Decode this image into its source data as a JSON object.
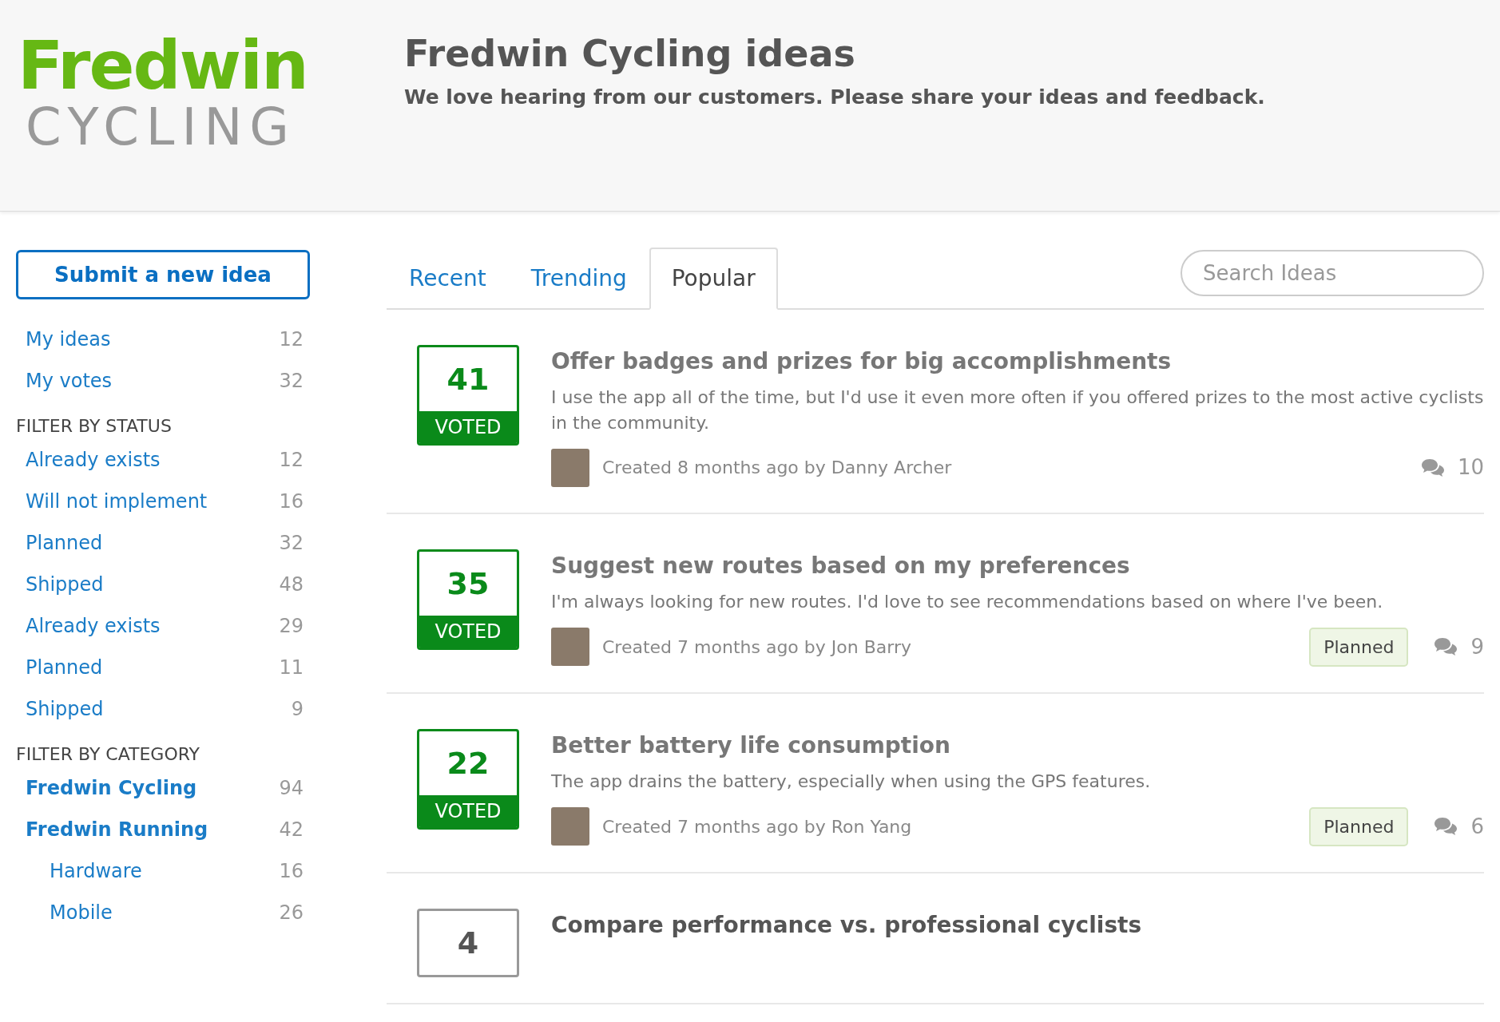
{
  "header": {
    "logo": {
      "brand": "Fredwin",
      "subtitle": "CYCLING"
    },
    "title": "Fredwin Cycling ideas",
    "tagline": "We love hearing from our customers. Please share your ideas and feedback."
  },
  "sidebar": {
    "submit_button": "Submit a new idea",
    "my_items": [
      {
        "label": "My ideas",
        "count": "12"
      },
      {
        "label": "My votes",
        "count": "32"
      }
    ],
    "status_heading": "FILTER BY STATUS",
    "statuses": [
      {
        "label": "Already exists",
        "count": "12"
      },
      {
        "label": "Will not implement",
        "count": "16"
      },
      {
        "label": "Planned",
        "count": "32"
      },
      {
        "label": "Shipped",
        "count": "48"
      },
      {
        "label": "Already exists",
        "count": "29"
      },
      {
        "label": "Planned",
        "count": "11"
      },
      {
        "label": "Shipped",
        "count": "9"
      }
    ],
    "category_heading": "FILTER BY CATEGORY",
    "categories": [
      {
        "label": "Fredwin Cycling",
        "count": "94"
      },
      {
        "label": "Fredwin Running",
        "count": "42",
        "children": [
          {
            "label": "Hardware",
            "count": "16"
          },
          {
            "label": "Mobile",
            "count": "26"
          }
        ]
      }
    ]
  },
  "tabs": [
    {
      "label": "Recent",
      "selected": false
    },
    {
      "label": "Trending",
      "selected": false
    },
    {
      "label": "Popular",
      "selected": true
    }
  ],
  "search": {
    "placeholder": "Search Ideas"
  },
  "ideas": [
    {
      "votes": "41",
      "voted": true,
      "vote_label": "VOTED",
      "title": "Offer badges and prizes for big accomplishments",
      "description": "I use the app all of the time, but I'd use it even more often if you offered prizes to the most active cyclists in the community.",
      "meta": "Created 8 months ago by Danny Archer",
      "comments": "10"
    },
    {
      "votes": "35",
      "voted": true,
      "vote_label": "VOTED",
      "title": "Suggest new routes based on my preferences",
      "description": "I'm always looking for new routes. I'd love to see recommendations based on where I've been.",
      "meta": "Created 7 months ago by Jon Barry",
      "status": "Planned",
      "comments": "9"
    },
    {
      "votes": "22",
      "voted": true,
      "vote_label": "VOTED",
      "title": "Better battery life consumption",
      "description": "The app drains the battery, especially when using the GPS features.",
      "meta": "Created 7 months ago by Ron Yang",
      "status": "Planned",
      "comments": "6"
    },
    {
      "votes": "4",
      "voted": false,
      "title": "Compare performance vs. professional cyclists"
    }
  ]
}
